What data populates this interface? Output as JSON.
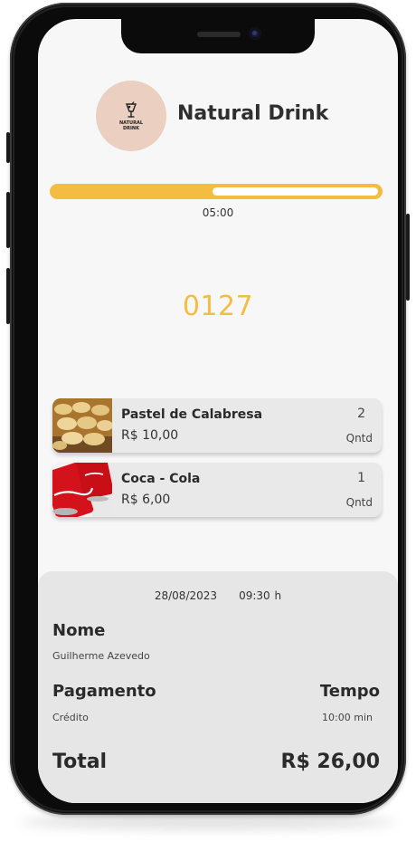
{
  "colors": {
    "accent": "#f4bd42",
    "logo_bg": "#ebcfc1",
    "panel_bg": "#e6e6e6"
  },
  "header": {
    "logo_text": "NATURAL DRINK",
    "logo_icon": "drink-glass-icon",
    "store_name": "Natural Drink"
  },
  "progress": {
    "fraction": 0.49,
    "timer": "05:00"
  },
  "order": {
    "number": "0127"
  },
  "items": [
    {
      "name": "Pastel de Calabresa",
      "price": "R$ 10,00",
      "qty": "2",
      "qty_label": "Qntd",
      "image": "pastel-photo"
    },
    {
      "name": "Coca - Cola",
      "price": "R$ 6,00",
      "qty": "1",
      "qty_label": "Qntd",
      "image": "coca-cola-cans-photo"
    }
  ],
  "summary": {
    "date": "28/08/2023",
    "time": "09:30 h",
    "name_label": "Nome",
    "name_value": "Guilherme Azevedo",
    "payment_label": "Pagamento",
    "payment_value": "Crédito",
    "time_label": "Tempo",
    "time_value": "10:00 min",
    "total_label": "Total",
    "total_value": "R$ 26,00"
  }
}
